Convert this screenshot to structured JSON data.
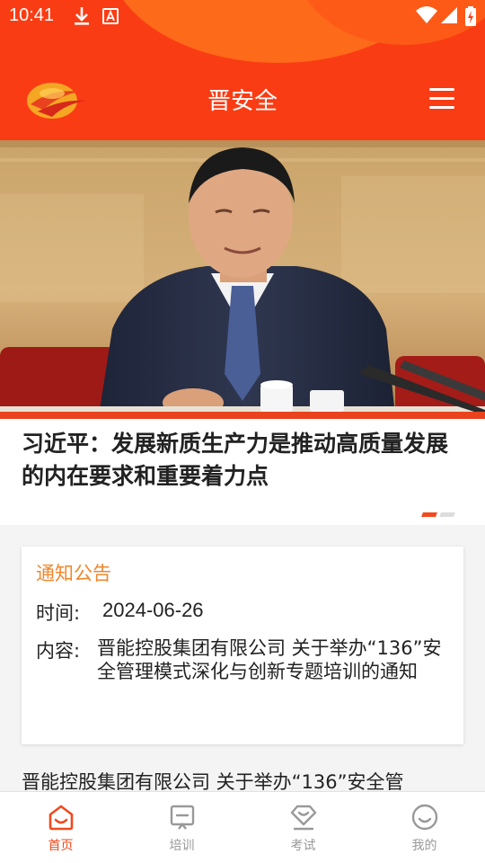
{
  "status_bar": {
    "time": "10:41",
    "icons": [
      "download-icon",
      "notification-a-icon",
      "wifi-icon",
      "signal-icon",
      "battery-charging-icon"
    ]
  },
  "header": {
    "title": "晋安全",
    "logo_icon": "jinneng-logo",
    "menu_icon": "hamburger-menu-icon",
    "background_color": "#fa3c14"
  },
  "banner": {
    "headline": "习近平：发展新质生产力是推动高质量发展的内在要求和重要着力点",
    "dots_count": 2,
    "active_dot": 0,
    "accent_color": "#f04a1e"
  },
  "notice": {
    "title": "通知公告",
    "time_label": "时间:",
    "time_value": "2024-06-26",
    "content_label": "内容:",
    "content_value": "晋能控股集团有限公司 关于举办“136”安全管理模式深化与创新专题培训的通知"
  },
  "article_preview": {
    "text": "晋能控股集团有限公司 关于举办“136”安全管"
  },
  "bottom_nav": {
    "items": [
      {
        "label": "首页",
        "icon": "home-icon",
        "active": true
      },
      {
        "label": "培训",
        "icon": "training-icon",
        "active": false
      },
      {
        "label": "考试",
        "icon": "exam-icon",
        "active": false
      },
      {
        "label": "我的",
        "icon": "profile-icon",
        "active": false
      }
    ],
    "active_color": "#f04a1e",
    "inactive_color": "#999999"
  }
}
